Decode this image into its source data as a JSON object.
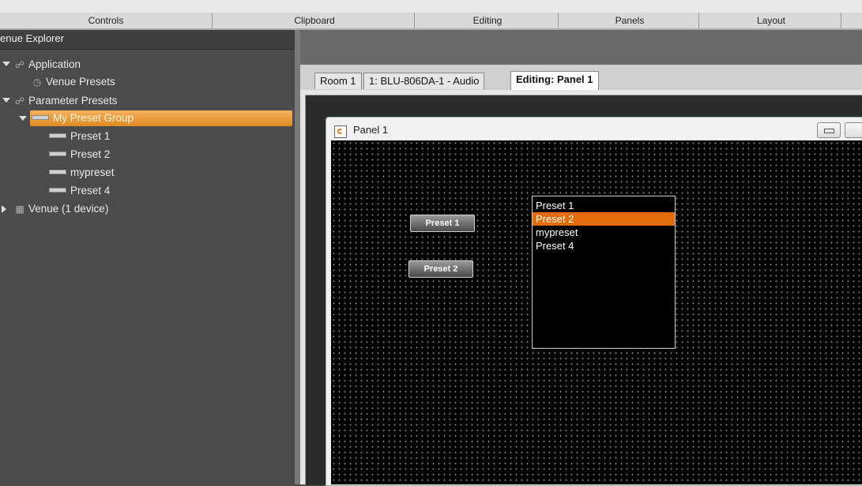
{
  "ribbon": {
    "groups": [
      "Controls",
      "Clipboard",
      "Editing",
      "Panels",
      "Layout"
    ]
  },
  "explorer": {
    "title": "enue Explorer",
    "tree": {
      "application": "Application",
      "venue_presets": "Venue Presets",
      "parameter_presets": "Parameter Presets",
      "my_preset_group": "My Preset Group",
      "presets": [
        "Preset 1",
        "Preset 2",
        "mypreset",
        "Preset 4"
      ],
      "venue": "Venue (1 device)"
    }
  },
  "tabs": [
    "Room 1",
    "1: BLU-806DA-1 - Audio",
    "Editing: Panel 1"
  ],
  "panel": {
    "title": "Panel 1",
    "buttons": [
      "Preset 1",
      "Preset 2"
    ],
    "list": {
      "items": [
        "Preset 1",
        "Preset 2",
        "mypreset",
        "Preset 4"
      ],
      "selected": "Preset 2"
    }
  },
  "colors": {
    "selection_orange": "#e36c09",
    "tree_selection": "#f0a040"
  }
}
